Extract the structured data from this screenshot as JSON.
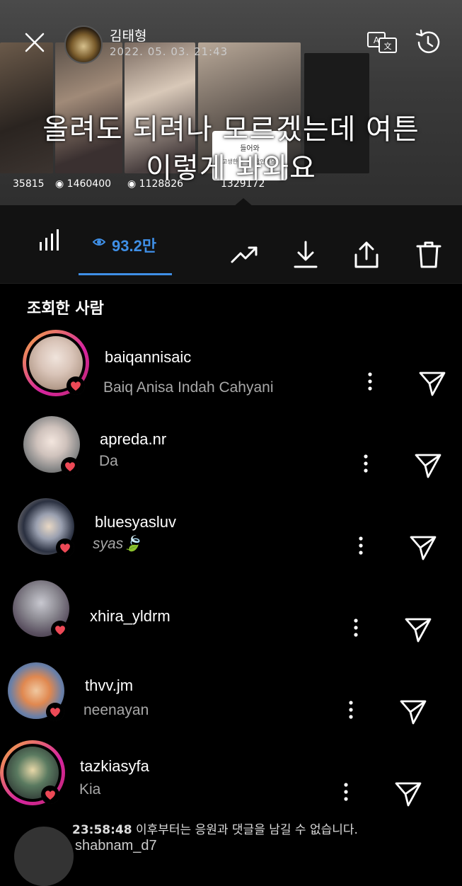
{
  "story_header": {
    "username": "김태형",
    "date": "2022. 05. 03. 21:43"
  },
  "story_overlay": {
    "line1": "올려도 되려나 모르겠는데 여튼",
    "line2": "이렇게 봐와요",
    "view_counts": [
      "35815",
      "1460400",
      "1128826",
      "1329172"
    ],
    "popup_title": "들어와",
    "popup_btn_1": "고생한",
    "popup_btn_2": "확인해요"
  },
  "toolbar": {
    "view_count": "93.2만"
  },
  "section_title": "조회한 사람",
  "viewers": [
    {
      "username": "baiqannisaic",
      "display_name": "Baiq Anisa Indah Cahyani"
    },
    {
      "username": "apreda.nr",
      "display_name": "Da"
    },
    {
      "username": "bluesyasluv",
      "display_name": "syas🍃"
    },
    {
      "username": "xhira_yldrm",
      "display_name": ""
    },
    {
      "username": "thvv.jm",
      "display_name": "neenayan"
    },
    {
      "username": "tazkiasyfa",
      "display_name": "Kia"
    }
  ],
  "footer": {
    "time": "23:58:48",
    "message": " 이후부터는 응원과 댓글을 남길 수 없습니다.",
    "next_username": "shabnam_d7"
  },
  "colors": {
    "accent": "#3f8fe6",
    "heart": "#ed4956",
    "background": "#000000",
    "toolbar_bg": "#121212"
  },
  "icons": [
    "close-icon",
    "translate-icon",
    "history-icon",
    "bar-chart-icon",
    "eye-icon",
    "trending-icon",
    "download-icon",
    "share-icon",
    "trash-icon",
    "more-vertical-icon",
    "send-icon",
    "heart-icon"
  ]
}
